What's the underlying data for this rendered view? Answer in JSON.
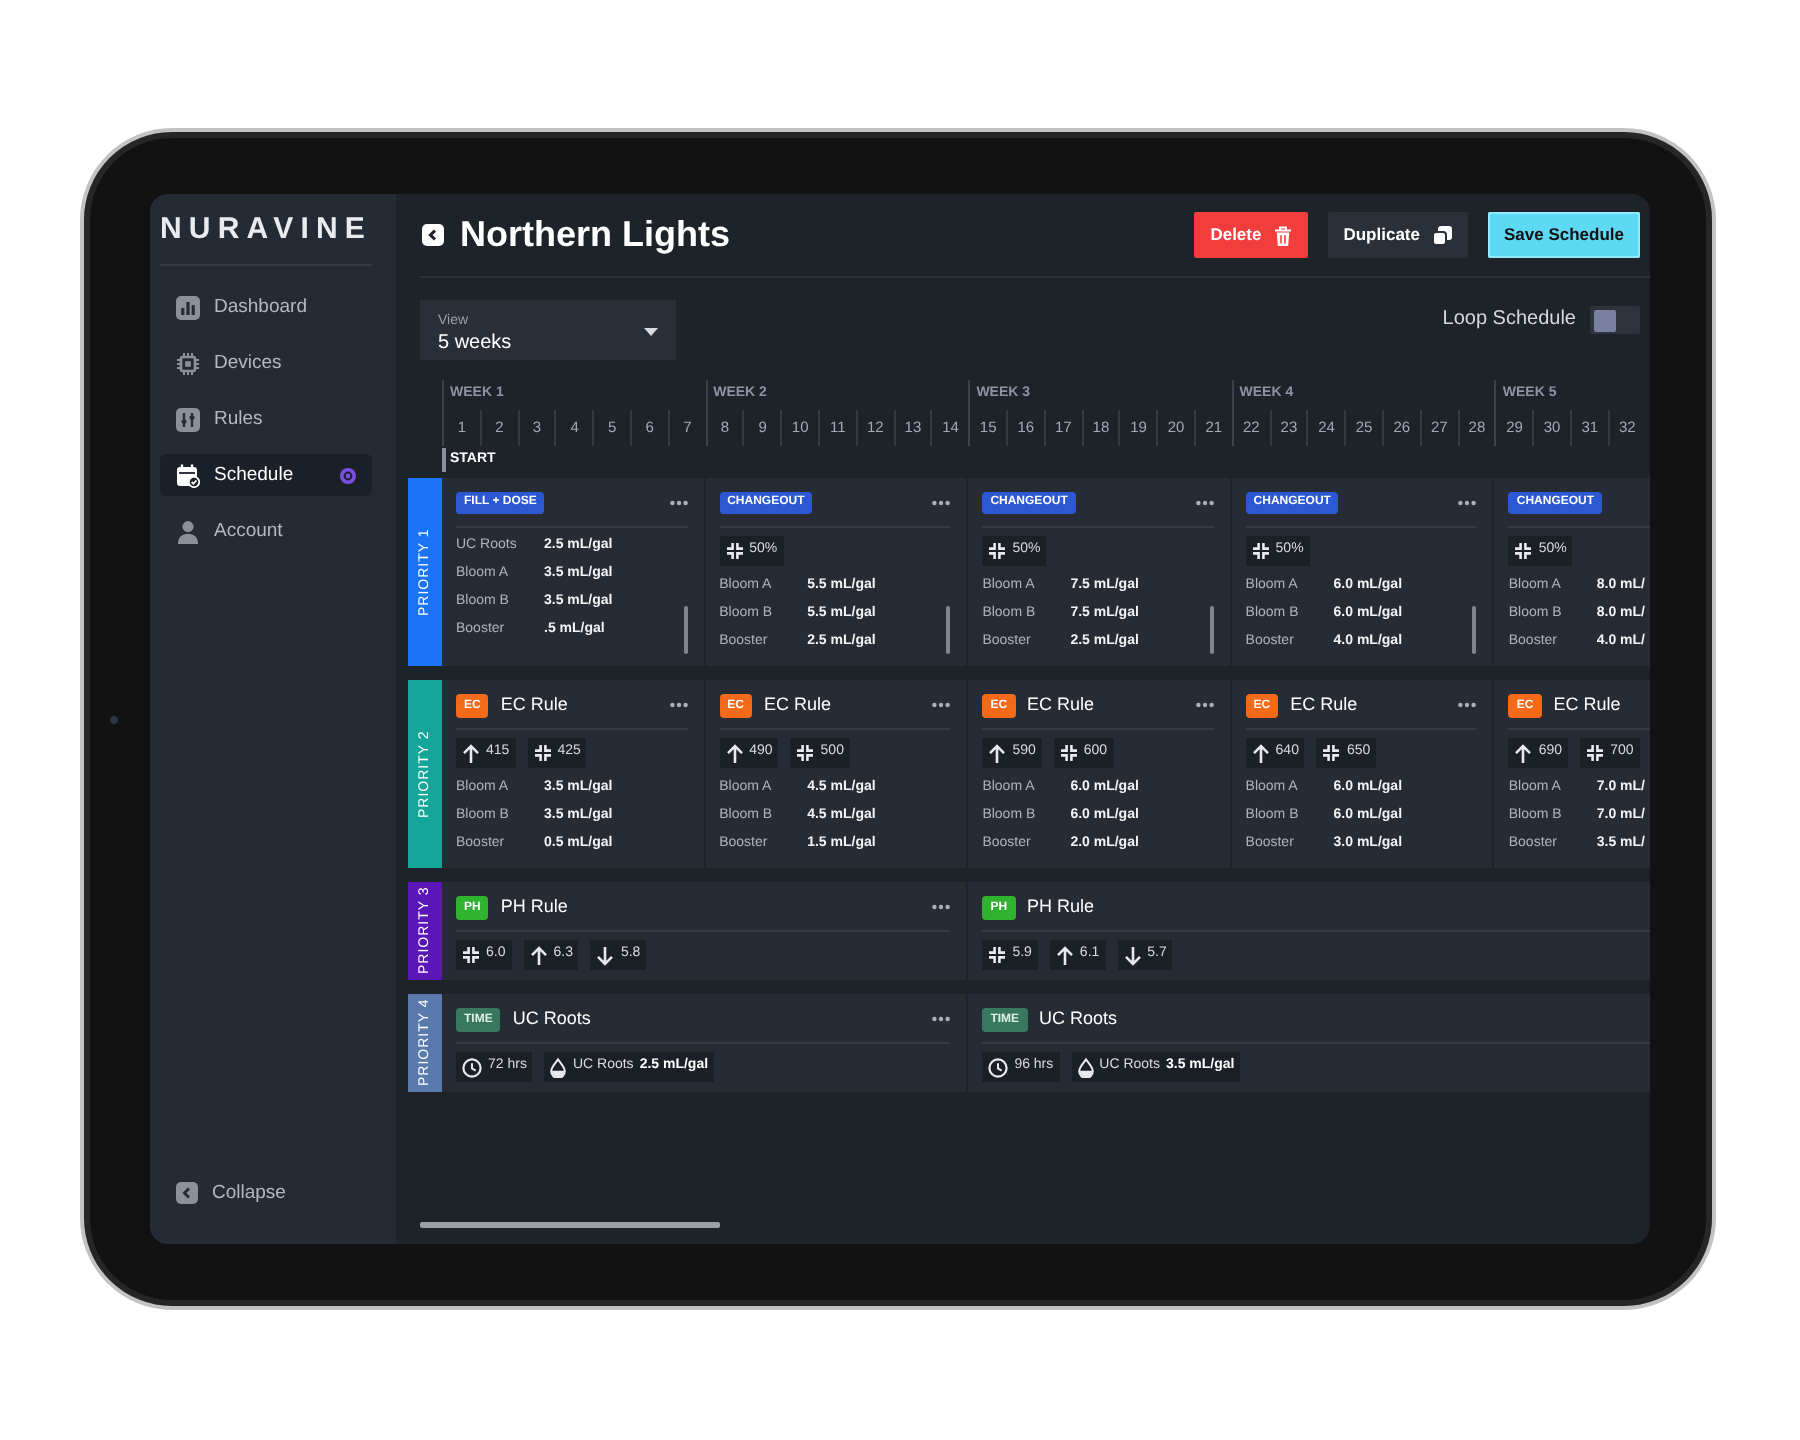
{
  "sidebar": {
    "logo": "NURAVINE",
    "items": [
      {
        "label": "Dashboard",
        "selected": false,
        "indicator": false
      },
      {
        "label": "Devices",
        "selected": false,
        "indicator": false
      },
      {
        "label": "Rules",
        "selected": false,
        "indicator": false
      },
      {
        "label": "Schedule",
        "selected": true,
        "indicator": true
      },
      {
        "label": "Account",
        "selected": false,
        "indicator": false
      }
    ],
    "collapse": "Collapse"
  },
  "header": {
    "title": "Northern Lights",
    "buttons": [
      {
        "label": "Delete",
        "kind": "danger"
      },
      {
        "label": "Duplicate",
        "kind": "secondary"
      },
      {
        "label": "Save Schedule",
        "kind": "primary"
      }
    ]
  },
  "view": {
    "label": "View",
    "value": "5 weeks"
  },
  "loop": {
    "label": "Loop Schedule",
    "on": false
  },
  "timeline": {
    "weeks": [
      {
        "label": "WEEK 1",
        "days": [
          "1",
          "2",
          "3",
          "4",
          "5",
          "6",
          "7"
        ]
      },
      {
        "label": "WEEK 2",
        "days": [
          "8",
          "9",
          "10",
          "11",
          "12",
          "13",
          "14"
        ]
      },
      {
        "label": "WEEK 3",
        "days": [
          "15",
          "16",
          "17",
          "18",
          "19",
          "20",
          "21"
        ]
      },
      {
        "label": "WEEK 4",
        "days": [
          "22",
          "23",
          "24",
          "25",
          "26",
          "27",
          "28"
        ]
      },
      {
        "label": "WEEK 5",
        "days": [
          "29",
          "30",
          "31",
          "32"
        ]
      }
    ],
    "start": "START"
  },
  "priorities": [
    {
      "label": "PRIORITY 1",
      "color": "#1a74f5",
      "rules": [
        {
          "kind": "dose",
          "badge": "FILL + DOSE",
          "menu": true,
          "handle": true,
          "doses": [
            {
              "name": "UC Roots",
              "amount": "2.5 mL/gal"
            },
            {
              "name": "Bloom A",
              "amount": "3.5 mL/gal"
            },
            {
              "name": "Bloom B",
              "amount": "3.5 mL/gal"
            },
            {
              "name": "Booster",
              "amount": ".5 mL/gal"
            }
          ]
        },
        {
          "kind": "dose",
          "badge": "CHANGEOUT",
          "menu": true,
          "handle": true,
          "chips": [
            {
              "kind": "target",
              "value": "50%"
            }
          ],
          "doses": [
            {
              "name": "Bloom A",
              "amount": "5.5 mL/gal"
            },
            {
              "name": "Bloom B",
              "amount": "5.5 mL/gal"
            },
            {
              "name": "Booster",
              "amount": "2.5 mL/gal"
            }
          ]
        },
        {
          "kind": "dose",
          "badge": "CHANGEOUT",
          "menu": true,
          "handle": true,
          "chips": [
            {
              "kind": "target",
              "value": "50%"
            }
          ],
          "doses": [
            {
              "name": "Bloom A",
              "amount": "7.5 mL/gal"
            },
            {
              "name": "Bloom B",
              "amount": "7.5 mL/gal"
            },
            {
              "name": "Booster",
              "amount": "2.5 mL/gal"
            }
          ]
        },
        {
          "kind": "dose",
          "badge": "CHANGEOUT",
          "menu": true,
          "handle": true,
          "chips": [
            {
              "kind": "target",
              "value": "50%"
            }
          ],
          "doses": [
            {
              "name": "Bloom A",
              "amount": "6.0 mL/gal"
            },
            {
              "name": "Bloom B",
              "amount": "6.0 mL/gal"
            },
            {
              "name": "Booster",
              "amount": "4.0 mL/gal"
            }
          ]
        },
        {
          "kind": "dose",
          "badge": "CHANGEOUT",
          "menu": false,
          "handle": false,
          "chips": [
            {
              "kind": "target",
              "value": "50%"
            }
          ],
          "doses": [
            {
              "name": "Bloom A",
              "amount": "8.0 mL/"
            },
            {
              "name": "Bloom B",
              "amount": "8.0 mL/"
            },
            {
              "name": "Booster",
              "amount": "4.0 mL/"
            }
          ]
        }
      ]
    },
    {
      "label": "PRIORITY 2",
      "color": "#15a69a",
      "rules": [
        {
          "kind": "ec",
          "badge": "EC",
          "title": "EC Rule",
          "menu": true,
          "handle": false,
          "chips": [
            {
              "kind": "raise",
              "value": "415"
            },
            {
              "kind": "target",
              "value": "425"
            }
          ],
          "doses": [
            {
              "name": "Bloom A",
              "amount": "3.5 mL/gal"
            },
            {
              "name": "Bloom B",
              "amount": "3.5 mL/gal"
            },
            {
              "name": "Booster",
              "amount": "0.5 mL/gal"
            }
          ]
        },
        {
          "kind": "ec",
          "badge": "EC",
          "title": "EC Rule",
          "menu": true,
          "handle": false,
          "chips": [
            {
              "kind": "raise",
              "value": "490"
            },
            {
              "kind": "target",
              "value": "500"
            }
          ],
          "doses": [
            {
              "name": "Bloom A",
              "amount": "4.5 mL/gal"
            },
            {
              "name": "Bloom B",
              "amount": "4.5 mL/gal"
            },
            {
              "name": "Booster",
              "amount": "1.5 mL/gal"
            }
          ]
        },
        {
          "kind": "ec",
          "badge": "EC",
          "title": "EC Rule",
          "menu": true,
          "handle": false,
          "chips": [
            {
              "kind": "raise",
              "value": "590"
            },
            {
              "kind": "target",
              "value": "600"
            }
          ],
          "doses": [
            {
              "name": "Bloom A",
              "amount": "6.0 mL/gal"
            },
            {
              "name": "Bloom B",
              "amount": "6.0 mL/gal"
            },
            {
              "name": "Booster",
              "amount": "2.0 mL/gal"
            }
          ]
        },
        {
          "kind": "ec",
          "badge": "EC",
          "title": "EC Rule",
          "menu": true,
          "handle": false,
          "chips": [
            {
              "kind": "raise",
              "value": "640"
            },
            {
              "kind": "target",
              "value": "650"
            }
          ],
          "doses": [
            {
              "name": "Bloom A",
              "amount": "6.0 mL/gal"
            },
            {
              "name": "Bloom B",
              "amount": "6.0 mL/gal"
            },
            {
              "name": "Booster",
              "amount": "3.0 mL/gal"
            }
          ]
        },
        {
          "kind": "ec",
          "badge": "EC",
          "title": "EC Rule",
          "menu": false,
          "handle": false,
          "chips": [
            {
              "kind": "raise",
              "value": "690"
            },
            {
              "kind": "target",
              "value": "700"
            }
          ],
          "doses": [
            {
              "name": "Bloom A",
              "amount": "7.0 mL/"
            },
            {
              "name": "Bloom B",
              "amount": "7.0 mL/"
            },
            {
              "name": "Booster",
              "amount": "3.5 mL/"
            }
          ]
        }
      ]
    },
    {
      "label": "PRIORITY 3",
      "color": "#5b16b8",
      "rules": [
        {
          "kind": "ph",
          "badge": "PH",
          "title": "PH Rule",
          "menu": true,
          "handle": false,
          "chips": [
            {
              "kind": "target",
              "value": "6.0"
            },
            {
              "kind": "raise",
              "value": "6.3"
            },
            {
              "kind": "lower",
              "value": "5.8"
            }
          ]
        },
        {
          "kind": "ph",
          "badge": "PH",
          "title": "PH Rule",
          "menu": false,
          "handle": false,
          "chips": [
            {
              "kind": "target",
              "value": "5.9"
            },
            {
              "kind": "raise",
              "value": "6.1"
            },
            {
              "kind": "lower",
              "value": "5.7"
            }
          ]
        }
      ]
    },
    {
      "label": "PRIORITY 4",
      "color": "#5a79ad",
      "rules": [
        {
          "kind": "time",
          "badge": "TIME",
          "title": "UC Roots",
          "menu": true,
          "handle": false,
          "chips": [
            {
              "kind": "duration",
              "value": "72 hrs"
            },
            {
              "kind": "dose",
              "name": "UC Roots",
              "value": "2.5 mL/gal"
            }
          ]
        },
        {
          "kind": "time",
          "badge": "TIME",
          "title": "UC Roots",
          "menu": false,
          "handle": false,
          "chips": [
            {
              "kind": "duration",
              "value": "96 hrs"
            },
            {
              "kind": "dose",
              "name": "UC Roots",
              "value": "3.5 mL/gal"
            }
          ]
        }
      ]
    }
  ]
}
